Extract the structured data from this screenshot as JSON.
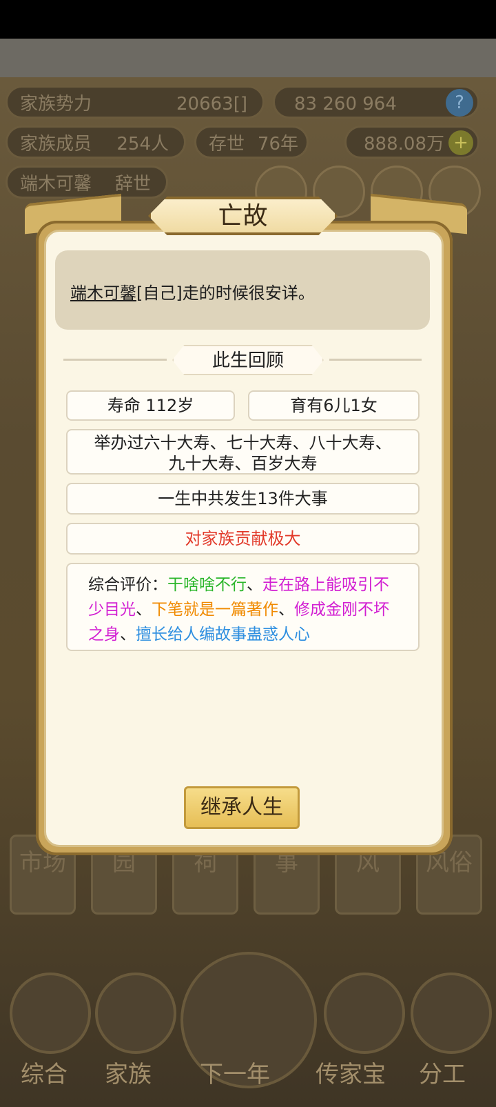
{
  "background": {
    "family_power_label": "家族势力",
    "family_power_value": "20663",
    "family_power_rank": "[]",
    "currency_a": "83",
    "currency_b": "260",
    "currency_c": "964",
    "help_icon": "?",
    "members_label": "家族成员",
    "members_value": "254人",
    "alive_label": "存世",
    "alive_value": "76年",
    "gold_value": "888.08万",
    "add_icon": "+",
    "person_name": "端木可馨",
    "person_status": "辞世",
    "bottom_tabs": [
      "市场",
      "园",
      "祠",
      "事",
      "风",
      "风俗"
    ],
    "nav": [
      "综合",
      "家族",
      "下一年",
      "传家宝",
      "分工"
    ]
  },
  "modal": {
    "title": "亡故",
    "death_name": "端木可馨",
    "death_suffix": "[自己]走的时候很安详。",
    "section_title": "此生回顾",
    "lifespan": "寿命 112岁",
    "children": "育有6儿1女",
    "celebrations_line1": "举办过六十大寿、七十大寿、八十大寿、",
    "celebrations_line2": "九十大寿、百岁大寿",
    "events": "一生中共发生13件大事",
    "contribution": "对家族贡献极大",
    "eval_label": "综合评价：",
    "eval_traits": [
      {
        "text": "干啥啥不行",
        "color": "#2bb62b"
      },
      {
        "text": "走在路上能吸引不少目光",
        "color": "#d21fd2"
      },
      {
        "text": "下笔就是一篇著作",
        "color": "#f08a00"
      },
      {
        "text": "修成金刚不坏之身",
        "color": "#d21fd2"
      },
      {
        "text": "擅长给人编故事蛊惑人心",
        "color": "#2f8fe0"
      }
    ],
    "separator": "、",
    "inherit_button": "继承人生",
    "contribution_color": "#e23a2a"
  }
}
